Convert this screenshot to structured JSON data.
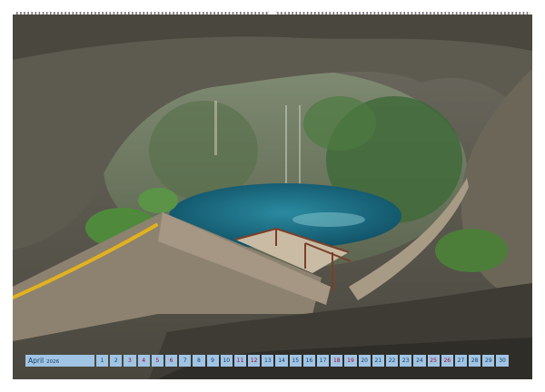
{
  "calendar": {
    "month": "April",
    "year": "2026",
    "days": [
      {
        "n": "1",
        "weekend": false
      },
      {
        "n": "2",
        "weekend": false
      },
      {
        "n": "3",
        "weekend": true
      },
      {
        "n": "4",
        "weekend": true
      },
      {
        "n": "5",
        "weekend": true
      },
      {
        "n": "6",
        "weekend": true
      },
      {
        "n": "7",
        "weekend": false
      },
      {
        "n": "8",
        "weekend": false
      },
      {
        "n": "9",
        "weekend": false
      },
      {
        "n": "10",
        "weekend": false
      },
      {
        "n": "11",
        "weekend": true
      },
      {
        "n": "12",
        "weekend": true
      },
      {
        "n": "13",
        "weekend": false
      },
      {
        "n": "14",
        "weekend": false
      },
      {
        "n": "15",
        "weekend": false
      },
      {
        "n": "16",
        "weekend": false
      },
      {
        "n": "17",
        "weekend": false
      },
      {
        "n": "18",
        "weekend": true
      },
      {
        "n": "19",
        "weekend": true
      },
      {
        "n": "20",
        "weekend": false
      },
      {
        "n": "21",
        "weekend": false
      },
      {
        "n": "22",
        "weekend": false
      },
      {
        "n": "23",
        "weekend": false
      },
      {
        "n": "24",
        "weekend": false
      },
      {
        "n": "25",
        "weekend": true
      },
      {
        "n": "26",
        "weekend": true
      },
      {
        "n": "27",
        "weekend": false
      },
      {
        "n": "28",
        "weekend": false
      },
      {
        "n": "29",
        "weekend": false
      },
      {
        "n": "30",
        "weekend": false
      }
    ]
  },
  "colors": {
    "calendar_cell": "#9fc4e4",
    "weekend_text": "#b0002a",
    "water": "#1f6f86"
  }
}
